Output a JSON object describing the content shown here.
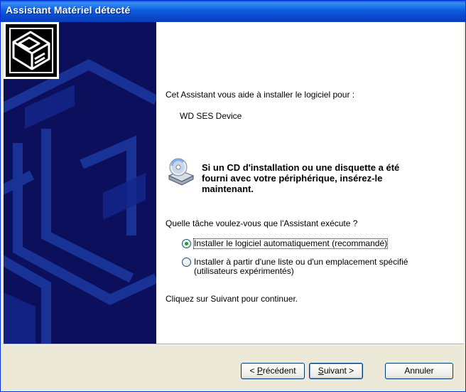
{
  "window": {
    "title": "Assistant Matériel détecté"
  },
  "main": {
    "intro": "Cet Assistant vous aide à installer le logiciel pour :",
    "device": "WD SES Device",
    "cd_notice_line1": "Si un CD d'installation ou une disquette a été",
    "cd_notice_line2": "fourni avec votre périphérique, insérez-le",
    "cd_notice_line3": "maintenant.",
    "question": "Quelle tâche voulez-vous que l'Assistant exécute ?",
    "options": [
      {
        "label": "Installer le logiciel automatiquement (recommandé)",
        "selected": true
      },
      {
        "label_line1": "Installer à partir d'une liste ou d'un emplacement spécifié",
        "label_line2": "(utilisateurs expérimentés)",
        "selected": false
      }
    ],
    "continue_hint": "Cliquez sur Suivant pour continuer."
  },
  "buttons": {
    "back_prefix": "< ",
    "back_mnemonic": "P",
    "back_rest": "récédent",
    "next_mnemonic": "S",
    "next_rest": "uivant >",
    "cancel": "Annuler"
  },
  "colors": {
    "titlebar": "#0A5BE0",
    "side_panel": "#0B0F5C",
    "dialog_bg": "#ECE9D8",
    "radio_selected": "#21A121"
  },
  "icons": [
    "hardware-wizard-icon",
    "cd-drive-icon"
  ]
}
